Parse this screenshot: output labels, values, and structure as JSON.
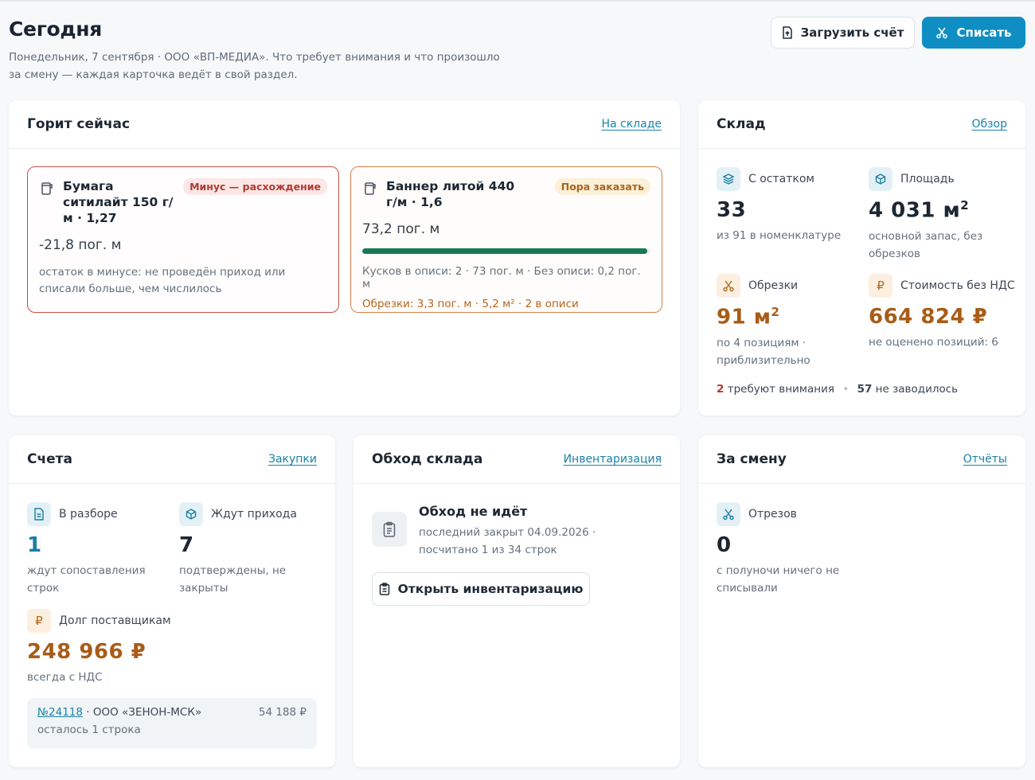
{
  "header": {
    "title": "Сегодня",
    "subtitle": "Понедельник, 7 сентября · ООО «ВП-МЕДИА». Что требует внимания и что произошло за смену — каждая карточка ведёт в свой раздел.",
    "upload_label": "Загрузить счёт",
    "writeoff_label": "Списать"
  },
  "urgent": {
    "title": "Горит сейчас",
    "link": "На складе",
    "items": [
      {
        "name": "Бумага ситилайт 150 г/м · 1,27",
        "badge": "Минус — расхождение",
        "value": "-21,8 пог. м",
        "note": "остаток в минусе: не проведён приход или списали больше, чем числилось"
      },
      {
        "name": "Баннер литой 440 г/м · 1,6",
        "badge": "Пора заказать",
        "value": "73,2 пог. м",
        "progress": 0.99,
        "meta": "Кусков в описи: 2 · 73 пог. м · Без описи: 0,2 пог. м",
        "scraps": "Обрезки: 3,3 пог. м · 5,2 м² · 2 в описи"
      }
    ]
  },
  "warehouse": {
    "title": "Склад",
    "link": "Обзор",
    "stats": [
      {
        "label": "С остатком",
        "value": "33",
        "desc": "из 91 в номенклатуре",
        "icon": "layers-icon"
      },
      {
        "label": "Площадь",
        "value": "4 031 м²",
        "desc": "основной запас, без обрезков",
        "icon": "box-icon"
      },
      {
        "label": "Обрезки",
        "value": "91 м²",
        "desc": "по 4 позициям · приблизительно",
        "icon": "scissors-icon"
      },
      {
        "label": "Стоимость без НДС",
        "value": "664 824 ₽",
        "desc": "не оценено позиций: 6",
        "icon": "ruble-icon"
      }
    ],
    "attention_count": "2",
    "attention_text": "требуют внимания",
    "never_count": "57",
    "never_text": "не заводилось"
  },
  "invoices": {
    "title": "Счета",
    "link": "Закупки",
    "stats": [
      {
        "label": "В разборе",
        "value": "1",
        "desc": "ждут сопоставления строк",
        "icon": "document-icon"
      },
      {
        "label": "Ждут прихода",
        "value": "7",
        "desc": "подтверждены, не закрыты",
        "icon": "box-icon"
      },
      {
        "label": "Долг поставщикам",
        "value": "248 966 ₽",
        "desc": "всегда с НДС",
        "icon": "ruble-icon"
      }
    ],
    "row": {
      "number": "№24118",
      "supplier": " · ООО «ЗЕНОН-МСК»",
      "amount": "54 188 ₽",
      "sub": "осталось 1 строка"
    }
  },
  "walk": {
    "title": "Обход склада",
    "link": "Инвентаризация",
    "status": "Обход не идёт",
    "desc": "последний закрыт 04.09.2026 · посчитано 1 из 34 строк",
    "button": "Открыть инвентаризацию"
  },
  "shift": {
    "title": "За смену",
    "link": "Отчёты",
    "stat": {
      "label": "Отрезов",
      "value": "0",
      "desc": "с полуночи ничего не списывали",
      "icon": "scissors-icon"
    }
  },
  "colors": {
    "accent": "#0f8ec4",
    "danger": "#c9504a",
    "warning": "#d7804a",
    "progress": "#177a55",
    "money": "#a85c17"
  }
}
